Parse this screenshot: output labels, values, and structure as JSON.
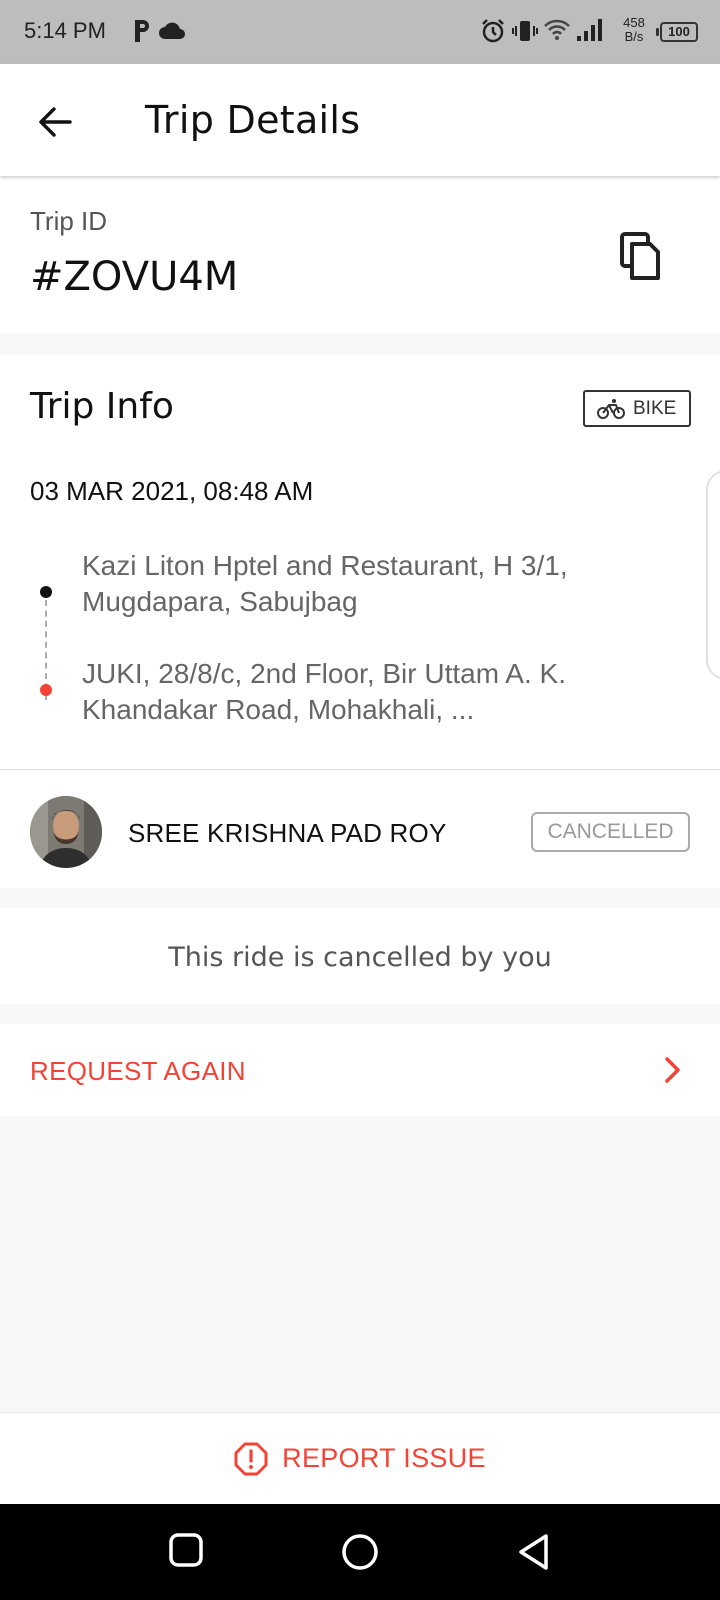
{
  "status_bar": {
    "time": "5:14 PM",
    "net_speed_value": "458",
    "net_speed_unit": "B/s",
    "battery": "100"
  },
  "header": {
    "title": "Trip Details"
  },
  "trip": {
    "id_label": "Trip ID",
    "id_value": "#ZOVU4M"
  },
  "trip_info": {
    "title": "Trip Info",
    "vehicle_type": "BIKE",
    "datetime": "03 MAR 2021, 08:48 AM",
    "pickup": "Kazi Liton Hptel and Restaurant, H 3/1, Mugdapara, Sabujbag",
    "drop": "JUKI, 28/8/c, 2nd Floor, Bir Uttam A. K. Khandakar Road, Mohakhali, ..."
  },
  "driver": {
    "name": "SREE KRISHNA PAD ROY",
    "status": "CANCELLED"
  },
  "cancel_note": "This ride is cancelled by you",
  "actions": {
    "request_again": "REQUEST AGAIN",
    "report_issue": "REPORT ISSUE"
  },
  "colors": {
    "accent_red": "#f44336",
    "status_bar_bg": "#bdbdbd",
    "nav_bar_bg": "#000000"
  },
  "icons": {
    "back": "arrow-left-icon",
    "copy": "copy-icon",
    "vehicle": "bicycle-icon",
    "chevron": "chevron-right-icon",
    "report": "alert-octagon-icon"
  }
}
